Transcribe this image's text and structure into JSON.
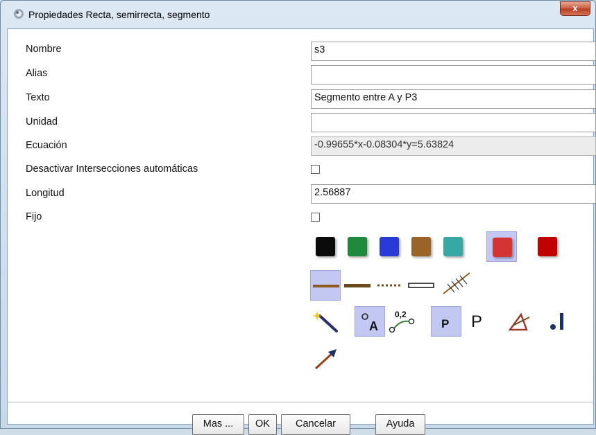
{
  "window": {
    "title": "Propiedades Recta, semirrecta, segmento",
    "close_label": "x"
  },
  "form": {
    "nombre": {
      "label": "Nombre",
      "value": "s3"
    },
    "alias": {
      "label": "Alias",
      "value": ""
    },
    "texto": {
      "label": "Texto",
      "value": "Segmento entre A y P3"
    },
    "unidad": {
      "label": "Unidad",
      "value": ""
    },
    "ecuacion": {
      "label": "Ecuación",
      "value": "-0.99655*x-0.08304*y=5.63824"
    },
    "desactivar": {
      "label": "Desactivar Intersecciones automáticas",
      "checked": false
    },
    "longitud": {
      "label": "Longitud",
      "value": "2.56887"
    },
    "fijo": {
      "label": "Fijo",
      "checked": false
    }
  },
  "colors": {
    "swatches": [
      "#0b0b0b",
      "#1f8a3c",
      "#2a3ad6",
      "#9a6428",
      "#36a9a5",
      "#d43434",
      "#c10000"
    ],
    "selected": 5
  },
  "display_icons": {
    "letter_p_label": "P",
    "label_value_text": "0,2",
    "bold_p_label": "P",
    "point_a_label": "A"
  },
  "buttons": {
    "mas": "Mas ...",
    "ok": "OK",
    "cancelar": "Cancelar",
    "ayuda": "Ayuda"
  }
}
